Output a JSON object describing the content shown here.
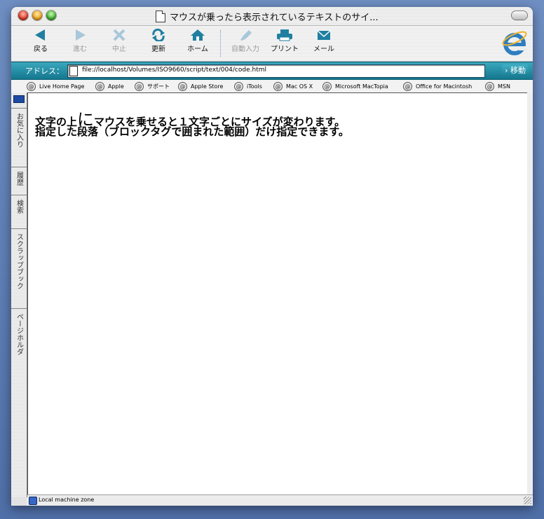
{
  "window": {
    "title": "マウスが乗ったら表示されているテキストのサイ..."
  },
  "toolbar": {
    "buttons": [
      {
        "label": "戻る"
      },
      {
        "label": "進む"
      },
      {
        "label": "中止"
      },
      {
        "label": "更新"
      },
      {
        "label": "ホーム"
      },
      {
        "label": "自動入力"
      },
      {
        "label": "プリント"
      },
      {
        "label": "メール"
      }
    ]
  },
  "address": {
    "label": "アドレス：",
    "value": "file://localhost/Volumes/ISO9660/script/text/004/code.html",
    "go_label": "› 移動"
  },
  "favorites": [
    "Live Home Page",
    "Apple",
    "サポート",
    "Apple Store",
    "iTools",
    "Mac OS X",
    "Microsoft MacTopia",
    "Office for Macintosh",
    "MSN"
  ],
  "sidebar": {
    "tabs": [
      "お気に入り",
      "履歴",
      "検索",
      "スクラップブック",
      "ページホルダ"
    ]
  },
  "content": {
    "line1_before": "文字の上",
    "line1_big": "に",
    "line1_after": "マウスを乗せると１文字ごとにサイズが変わります。",
    "line2": "指定した段落（ブロックタグで囲まれた範囲）だけ指定できます。"
  },
  "status": {
    "zone": "Local machine zone"
  },
  "colors": {
    "address_bar": "#1f8aa2",
    "accent_blue": "#1d4aa3"
  }
}
